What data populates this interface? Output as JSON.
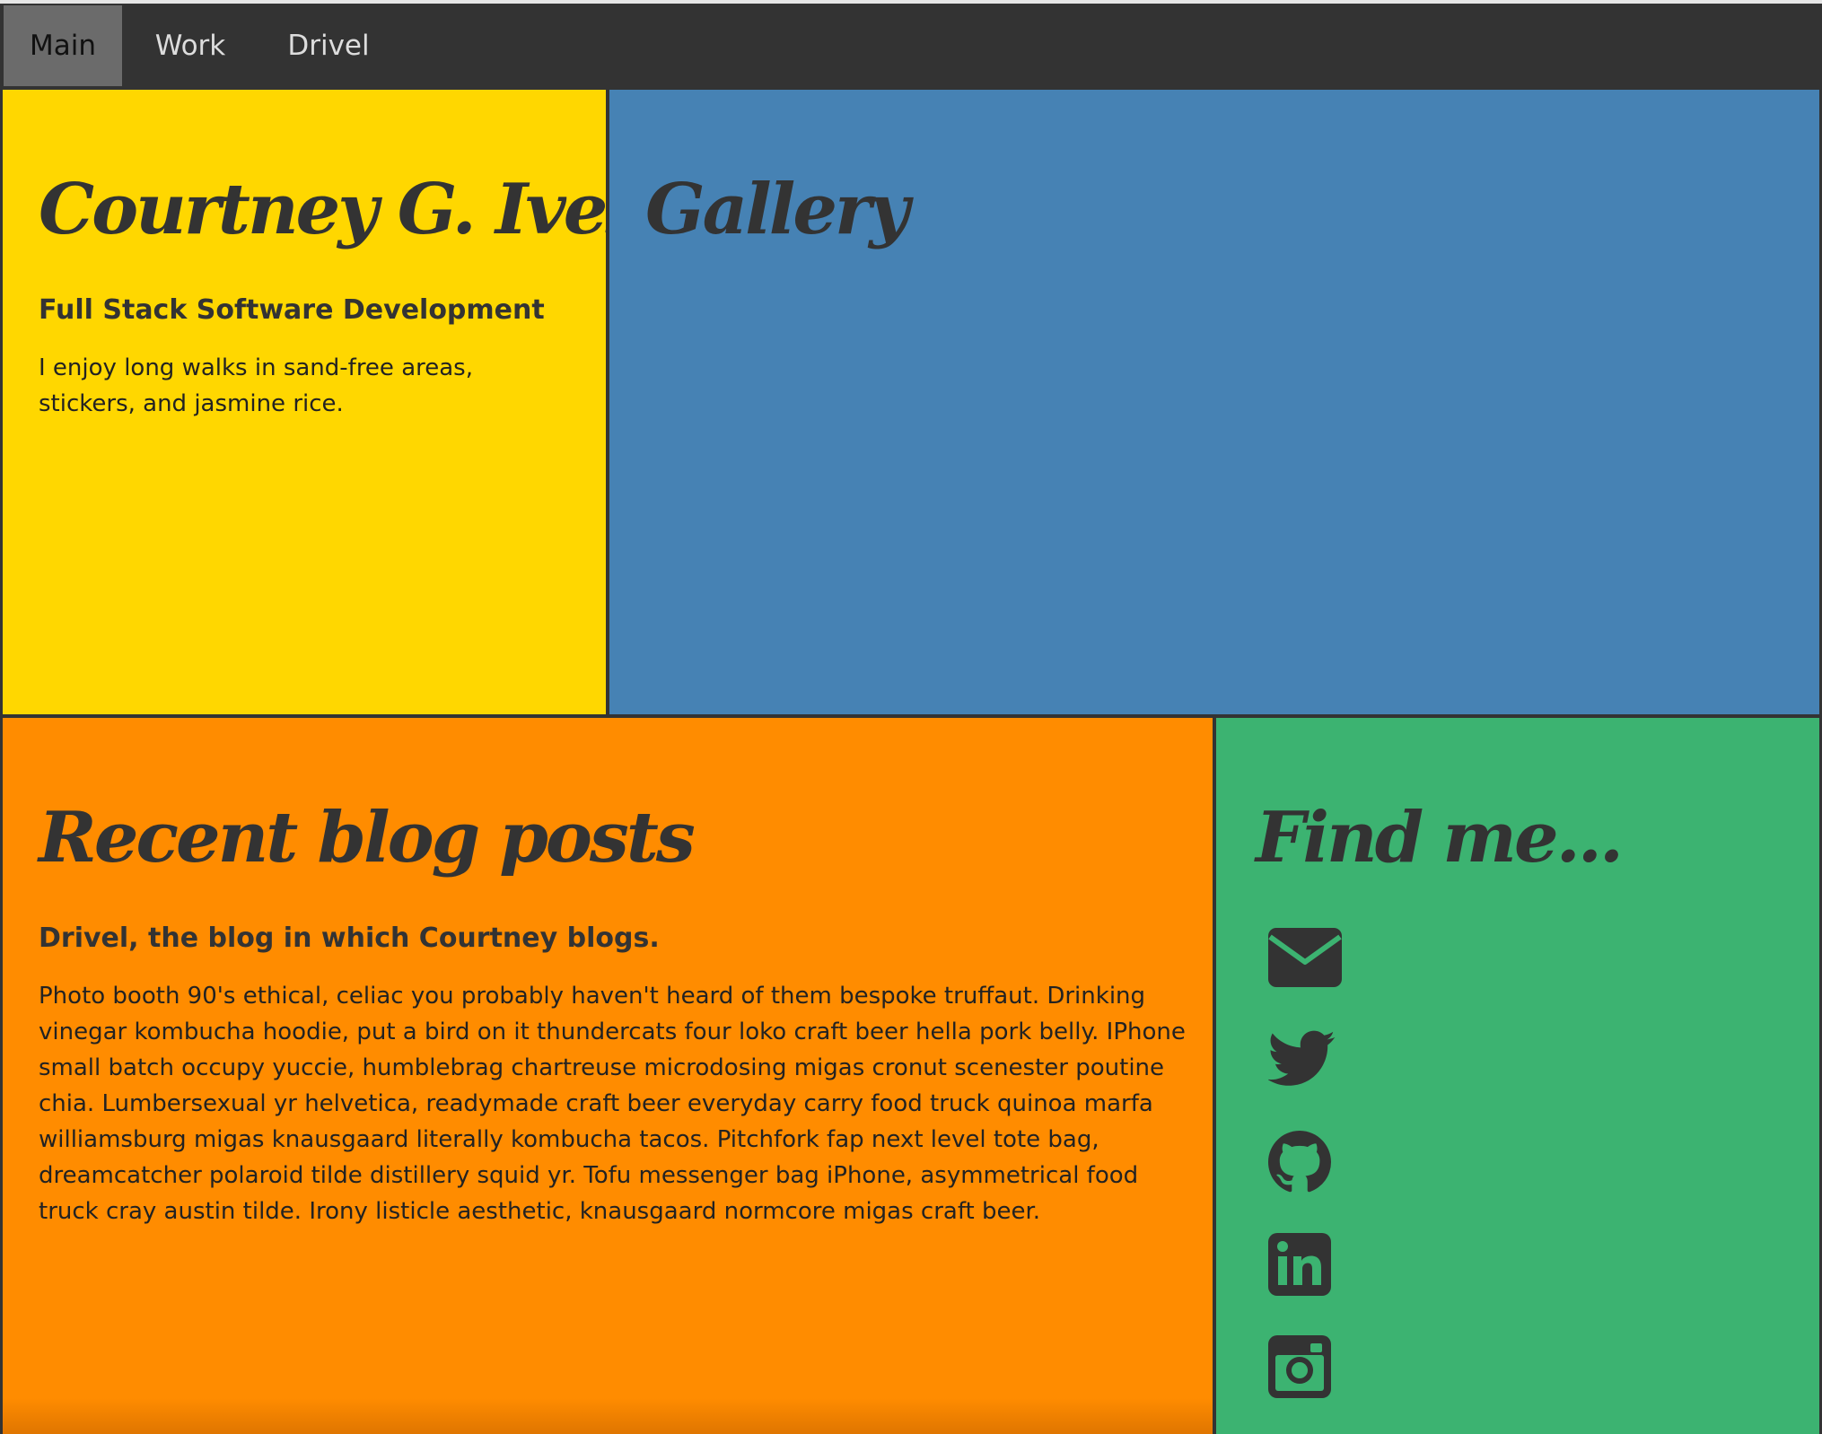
{
  "nav": {
    "items": [
      {
        "label": "Main",
        "active": true
      },
      {
        "label": "Work",
        "active": false
      },
      {
        "label": "Drivel",
        "active": false
      }
    ]
  },
  "about": {
    "title": "Courtney G. Ives",
    "subtitle": "Full Stack Software Development",
    "body": "I enjoy long walks in sand-free areas, stickers, and jasmine rice."
  },
  "gallery": {
    "title": "Gallery"
  },
  "blog": {
    "title": "Recent blog posts",
    "subtitle": "Drivel, the blog in which Courtney blogs.",
    "body": "Photo booth 90's ethical, celiac you probably haven't heard of them bespoke truffaut. Drinking vinegar kombucha hoodie, put a bird on it thundercats four loko craft beer hella pork belly. IPhone small batch occupy yuccie, humblebrag chartreuse microdosing migas cronut scenester poutine chia. Lumbersexual yr helvetica, readymade craft beer everyday carry food truck quinoa marfa williamsburg migas knausgaard literally kombucha tacos. Pitchfork fap next level tote bag, dreamcatcher polaroid tilde distillery squid yr. Tofu messenger bag iPhone, asymmetrical food truck cray austin tilde. Irony listicle aesthetic, knausgaard normcore migas craft beer."
  },
  "find": {
    "title": "Find me...",
    "icons": [
      "envelope-icon",
      "twitter-icon",
      "github-icon",
      "linkedin-icon",
      "instagram-icon"
    ]
  },
  "colors": {
    "nav_bg": "#333333",
    "nav_active_bg": "#6b6b6b",
    "about_bg": "#ffd700",
    "gallery_bg": "#4682b4",
    "blog_bg": "#ff8c00",
    "find_bg": "#3cb371",
    "text": "#333333"
  }
}
